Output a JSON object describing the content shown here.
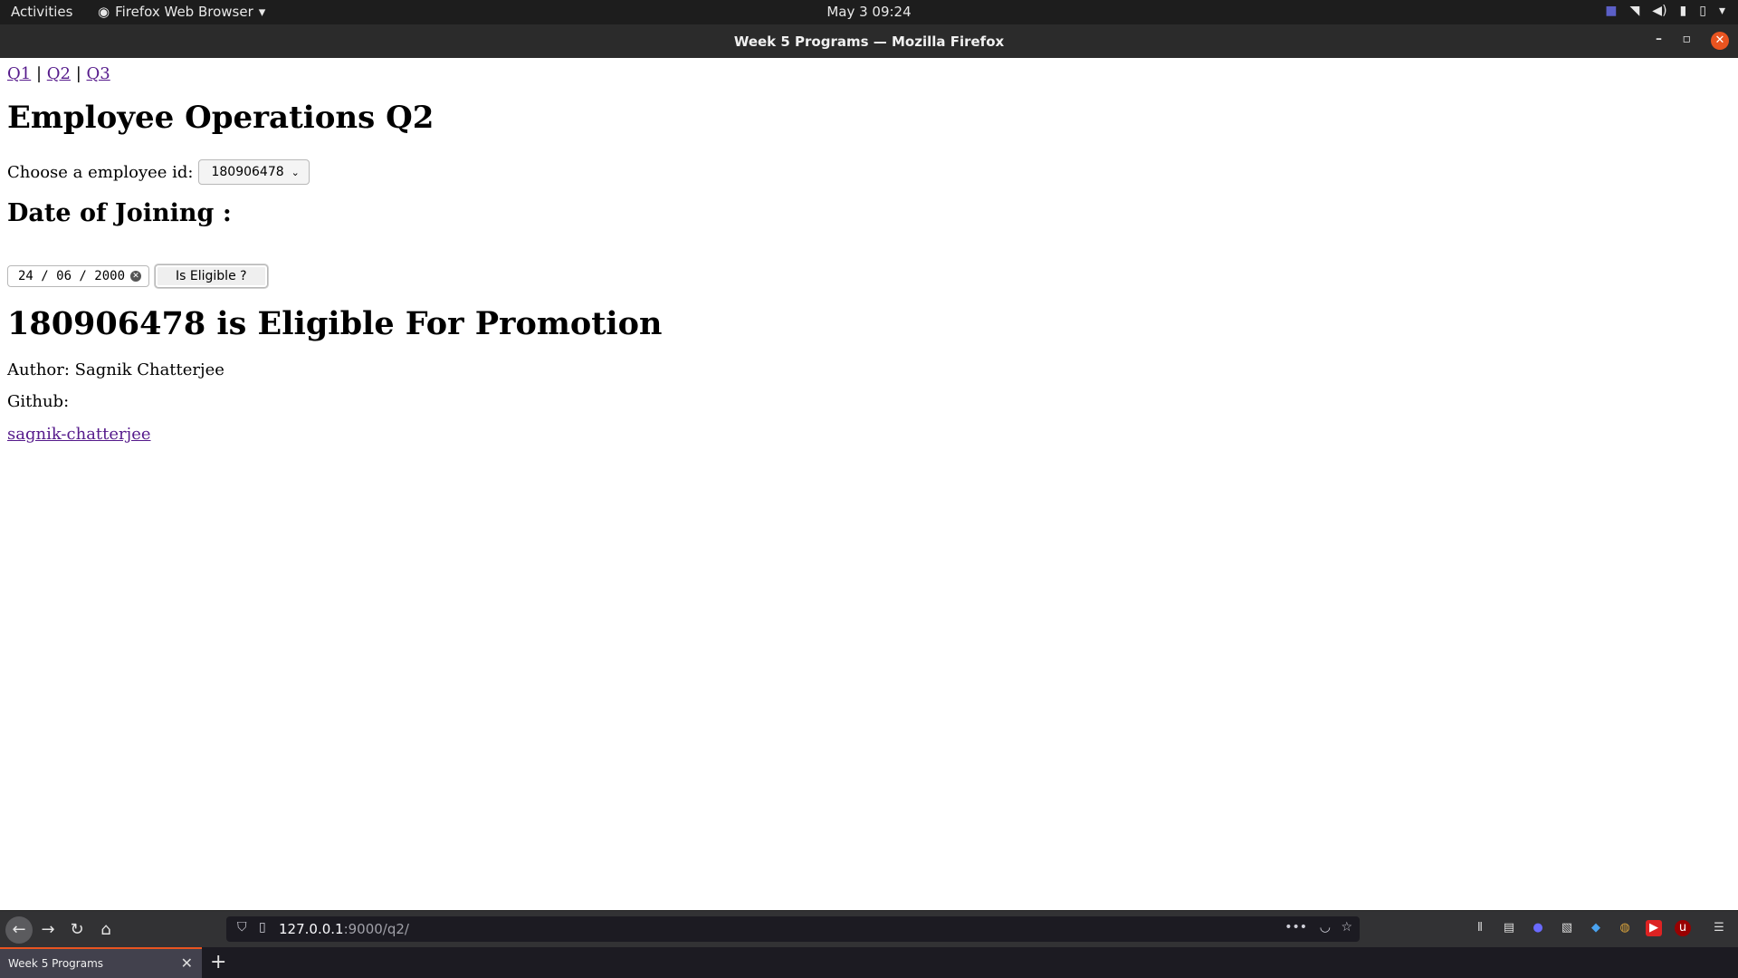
{
  "system_bar": {
    "activities": "Activities",
    "app_name": "Firefox Web Browser",
    "clock": "May 3  09:24"
  },
  "window": {
    "title": "Week 5 Programs — Mozilla Firefox"
  },
  "page": {
    "nav": [
      "Q1",
      "Q2",
      "Q3"
    ],
    "nav_separator": "|",
    "heading": "Employee Operations Q2",
    "choose_label": "Choose a employee id:",
    "employee_id_selected": "180906478",
    "doj_heading": "Date of Joining :",
    "date_value": "24 / 06 / 2000",
    "eligible_button": "Is Eligible ?",
    "result": "180906478 is Eligible For Promotion",
    "author": "Author: Sagnik Chatterjee",
    "github_label": "Github:",
    "github_link": "sagnik-chatterjee"
  },
  "browser": {
    "url_host": "127.0.0.1",
    "url_path": ":9000/q2/",
    "tab_title": "Week 5 Programs"
  },
  "colors": {
    "accent": "#e95420",
    "link_visited": "#551a8b",
    "link": "#0000ee"
  }
}
